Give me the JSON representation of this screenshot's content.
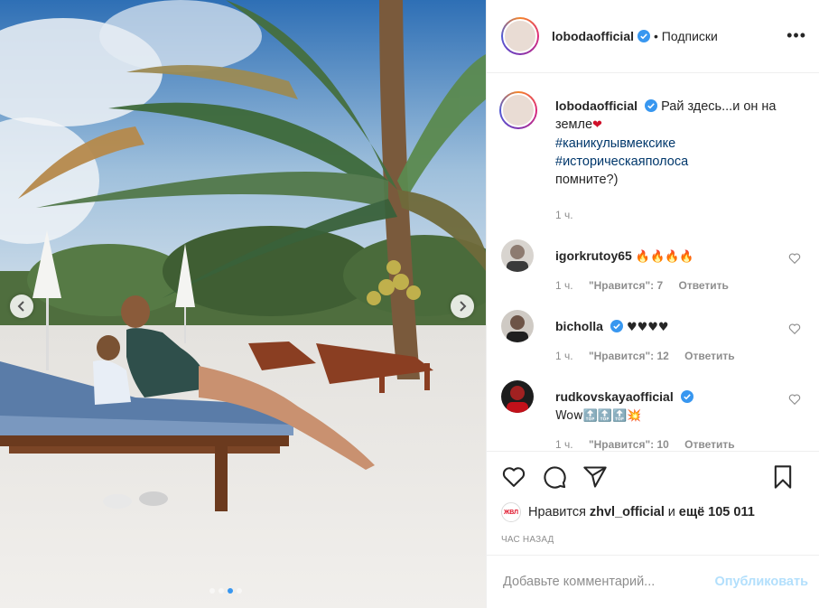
{
  "post": {
    "author": "lobodaofficial",
    "follow_label": "• Подписки",
    "more_label": "•••",
    "caption_text": "Рай здесь...и он на земле",
    "caption_emoji": "❤",
    "hashtags": [
      "#каникулывмексике",
      "#историческаяполоса"
    ],
    "caption_tail": "помните?)",
    "caption_time": "1 ч."
  },
  "comments": [
    {
      "user": "igorkrutoy65",
      "verified": false,
      "text": "🔥🔥🔥🔥",
      "time": "1 ч.",
      "likes": "\"Нравится\": 7",
      "reply": "Ответить"
    },
    {
      "user": "bicholla",
      "verified": true,
      "text": "♥♥♥♥",
      "time": "1 ч.",
      "likes": "\"Нравится\": 12",
      "reply": "Ответить"
    },
    {
      "user": "rudkovskayaofficial",
      "verified": true,
      "text": "Wow🔝🔝🔝💥",
      "time": "1 ч.",
      "likes": "\"Нравится\": 10",
      "reply": "Ответить"
    }
  ],
  "likes": {
    "prefix": "Нравится",
    "user": "zhvl_official",
    "middle": "и",
    "count": "ещё 105 011",
    "liker_avatar_text": "ЖВЛ"
  },
  "time_ago": "час назад",
  "add_comment": {
    "placeholder": "Добавьте комментарий...",
    "publish_label": "Опубликовать"
  },
  "carousel": {
    "slides": 4,
    "active": 2
  },
  "colors": {
    "link": "#00376b",
    "verified": "#3897f0",
    "publish": "#b2dffc"
  }
}
